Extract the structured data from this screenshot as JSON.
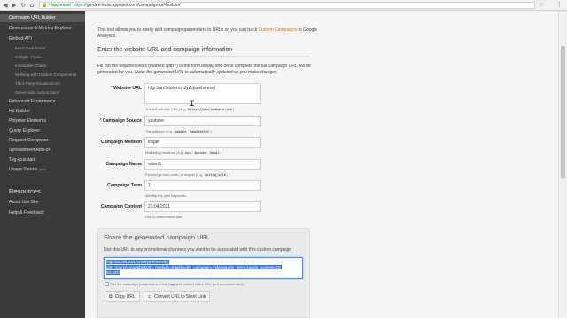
{
  "browser": {
    "secure_label": "Надежный",
    "url_scheme": "https://",
    "url_rest": "ga-dev-tools.appspot.com/campaign-url-builder/"
  },
  "sidebar": {
    "items": [
      {
        "label": "Campaign URL Builder",
        "active": true
      },
      {
        "label": "Dimensions & Metrics Explorer"
      },
      {
        "label": "Embed API"
      },
      {
        "label": "Basic Dashboard",
        "sub": true
      },
      {
        "label": "Multiple Views",
        "sub": true
      },
      {
        "label": "Interactive Charts",
        "sub": true
      },
      {
        "label": "Working with Custom Components",
        "sub": true
      },
      {
        "label": "Third Party Visualizations",
        "sub": true
      },
      {
        "label": "Server-side Authorization",
        "sub": true
      },
      {
        "label": "Enhanced Ecommerce"
      },
      {
        "label": "Hit Builder"
      },
      {
        "label": "Polymer Elements"
      },
      {
        "label": "Query Explorer"
      },
      {
        "label": "Request Composer"
      },
      {
        "label": "Spreadsheet Add-on"
      },
      {
        "label": "Tag Assistant"
      },
      {
        "label": "Usage Trends",
        "badge": "New!"
      }
    ],
    "resources_title": "Resources",
    "resources": [
      "About this Site",
      "Help & Feedback"
    ]
  },
  "intro": {
    "text1": "This tool allows you to easily add campaign parameters to URLs so you can track",
    "link": "Custom Campaigns",
    "text2": "in Google",
    "text3": "Analytics."
  },
  "form_section": {
    "title": "Enter the website URL and campaign information",
    "desc1": "Fill out the required fields (marked with *) in the form below, and once complete the full campaign URL will be",
    "desc2": "generated for you.",
    "desc2_note": "Note: the generated URL is automatically updated as you make changes."
  },
  "fields": {
    "website_url": {
      "label": "Website URL",
      "value": "http://architutors.ru/yuliya-elseeva/",
      "hint_pre": "The full website URL (e.g.",
      "hint_code": "https://www.example.com",
      "hint_post": ")"
    },
    "source": {
      "label": "Campaign Source",
      "value": "youtube",
      "hint_pre": "The referrer: (e.g.",
      "hint_code1": "google",
      "hint_code2": "newsletter",
      "hint_post": ")"
    },
    "medium": {
      "label": "Campaign Medium",
      "value": "traget",
      "hint_pre": "Marketing medium: (e.g.",
      "hint_code1": "cpc",
      "hint_code2": "banner",
      "hint_code3": "email",
      "hint_post": ")"
    },
    "name": {
      "label": "Campaign Name",
      "value": "video5",
      "hint_pre": "Product, promo code, or slogan (e.g.",
      "hint_code": "spring_sale",
      "hint_post": ")"
    },
    "term": {
      "label": "Campaign Term",
      "value": "1",
      "hint": "Identify the paid keywords"
    },
    "content": {
      "label": "Campaign Content",
      "value": "20.04.2021",
      "hint": "Use to differentiate ads"
    }
  },
  "share": {
    "title": "Share the generated campaign URL",
    "desc": "Use this URL in any promotional channels you want to be associated with this custom campaign",
    "url_line1": "http://architutors.ru/yuliya-elseeva/?",
    "url_line2": "utm_source=youtube&utm_medium=traget&utm_campaign=video5&utm_term=1&utm_content=20.",
    "url_line3": "04.2021",
    "fragment_label": "Set the campaign parameters in the fragment portion of the URL (not recommended).",
    "copy_label": "Copy URL",
    "short_label": "Convert URL to Short Link"
  }
}
